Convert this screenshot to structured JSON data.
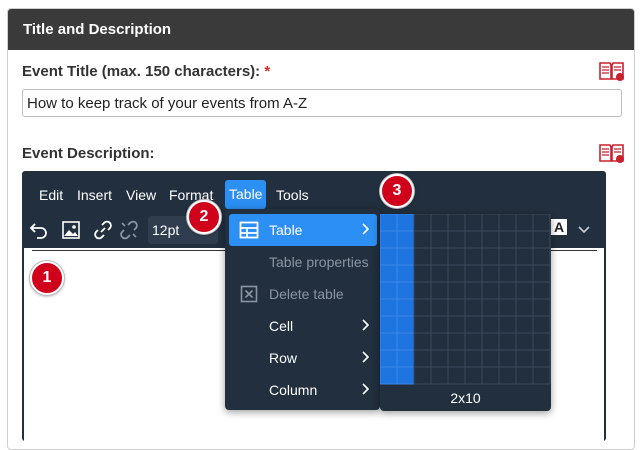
{
  "panel": {
    "title": "Title and Description"
  },
  "event_title": {
    "label": "Event Title (max. 150 characters):",
    "required_mark": "*",
    "value": "How to keep track of your events from A-Z"
  },
  "event_description": {
    "label": "Event Description:"
  },
  "editor": {
    "menubar": [
      "Edit",
      "Insert",
      "View",
      "Format",
      "Table",
      "Tools"
    ],
    "active_menu": "Table",
    "font_size": "12pt",
    "text_color_label": "A"
  },
  "table_menu": {
    "items": [
      {
        "label": "Table",
        "icon": "table-icon",
        "submenu": true,
        "highlighted": true,
        "disabled": false
      },
      {
        "label": "Table properties",
        "submenu": false,
        "highlighted": false,
        "disabled": true
      },
      {
        "label": "Delete table",
        "icon": "delete-table-icon",
        "submenu": false,
        "highlighted": false,
        "disabled": true
      },
      {
        "label": "Cell",
        "submenu": true,
        "highlighted": false,
        "disabled": false
      },
      {
        "label": "Row",
        "submenu": true,
        "highlighted": false,
        "disabled": false
      },
      {
        "label": "Column",
        "submenu": true,
        "highlighted": false,
        "disabled": false
      }
    ]
  },
  "table_grid": {
    "columns": 10,
    "rows": 10,
    "selected_cols": 2,
    "selected_rows": 10,
    "size_label": "2x10"
  },
  "markers": [
    "1",
    "2",
    "3"
  ],
  "colors": {
    "header_bg": "#3a3a3a",
    "editor_bg": "#222f3e",
    "accent": "#2b8ff3",
    "grid_selected": "#1f75e0",
    "marker_red": "#d0021b",
    "required_red": "#d9262b"
  }
}
